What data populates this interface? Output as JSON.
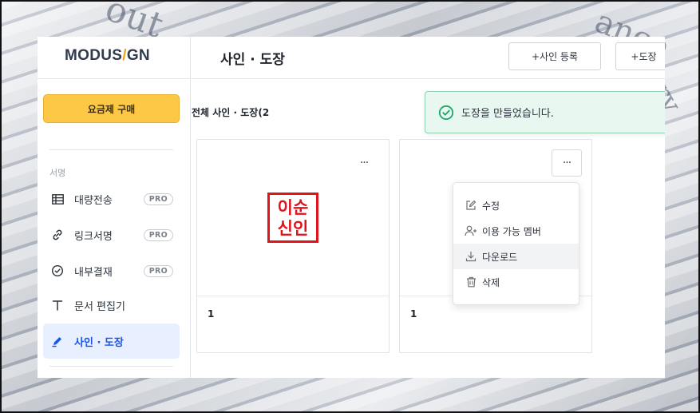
{
  "logo": {
    "pre": "MODUS",
    "slash": "/",
    "post": "GN"
  },
  "sidebar": {
    "buy_label": "요금제 구매",
    "section_label": "서명",
    "items": [
      {
        "label": "대량전송",
        "badge": "PRO",
        "icon": "table-icon"
      },
      {
        "label": "링크서명",
        "badge": "PRO",
        "icon": "link-icon"
      },
      {
        "label": "내부결재",
        "badge": "PRO",
        "icon": "check-circle-icon"
      },
      {
        "label": "문서 편집기",
        "badge": "",
        "icon": "text-icon"
      },
      {
        "label": "사인 · 도장",
        "badge": "",
        "icon": "pen-icon",
        "active": true
      }
    ]
  },
  "header": {
    "title": "사인 · 도장",
    "add_sign_label": "+사인 등록",
    "add_stamp_label": "+도장"
  },
  "list": {
    "title": "전체 사인 · 도장(2"
  },
  "cards": [
    {
      "name": "1",
      "stamp_line1": "이순",
      "stamp_line2": "신인",
      "more": "···"
    },
    {
      "name": "1",
      "more": "···"
    }
  ],
  "dropdown": {
    "items": [
      {
        "label": "수정",
        "icon": "edit-icon"
      },
      {
        "label": "이용 가능 멤버",
        "icon": "user-plus-icon"
      },
      {
        "label": "다운로드",
        "icon": "download-icon"
      },
      {
        "label": "삭제",
        "icon": "trash-icon"
      }
    ]
  },
  "toast": {
    "message": "도장을 만들었습니다."
  },
  "colors": {
    "accent": "#1c55e6",
    "buy_button": "#fcc845",
    "stamp_red": "#e0121a",
    "toast_bg": "#e9f7f1",
    "toast_icon": "#1aa866"
  }
}
